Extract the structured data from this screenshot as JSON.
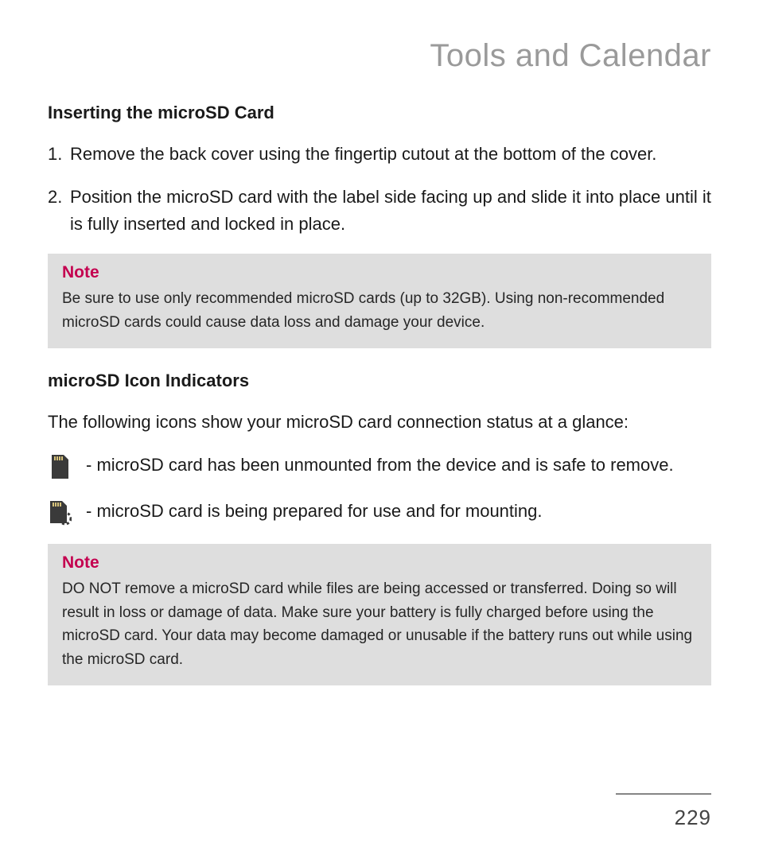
{
  "header": {
    "title": "Tools and Calendar"
  },
  "section1": {
    "heading": "Inserting the microSD Card",
    "steps": [
      {
        "num": "1.",
        "text": "Remove the back cover using the fingertip cutout at the bottom of the cover."
      },
      {
        "num": "2.",
        "text": "Position the microSD card with the label side facing up and slide it into place until it is fully inserted and locked in place."
      }
    ],
    "note": {
      "label": "Note",
      "body": "Be sure to use only recommended microSD cards (up to 32GB). Using non-recommended microSD cards could cause data loss and damage your device."
    }
  },
  "section2": {
    "heading": "microSD Icon Indicators",
    "intro": "The following icons show your microSD card connection status at a glance:",
    "items": [
      {
        "desc": "-  microSD card has been unmounted from the device and is safe to remove."
      },
      {
        "desc": "- microSD card is being prepared for use and for mounting."
      }
    ],
    "note": {
      "label": "Note",
      "body": "DO NOT remove a microSD card while files are being accessed or transferred. Doing so will result in loss or damage of data. Make sure your battery is fully charged before using the microSD card. Your data may become damaged or unusable if the battery runs out while using the microSD card."
    }
  },
  "footer": {
    "page_number": "229"
  }
}
